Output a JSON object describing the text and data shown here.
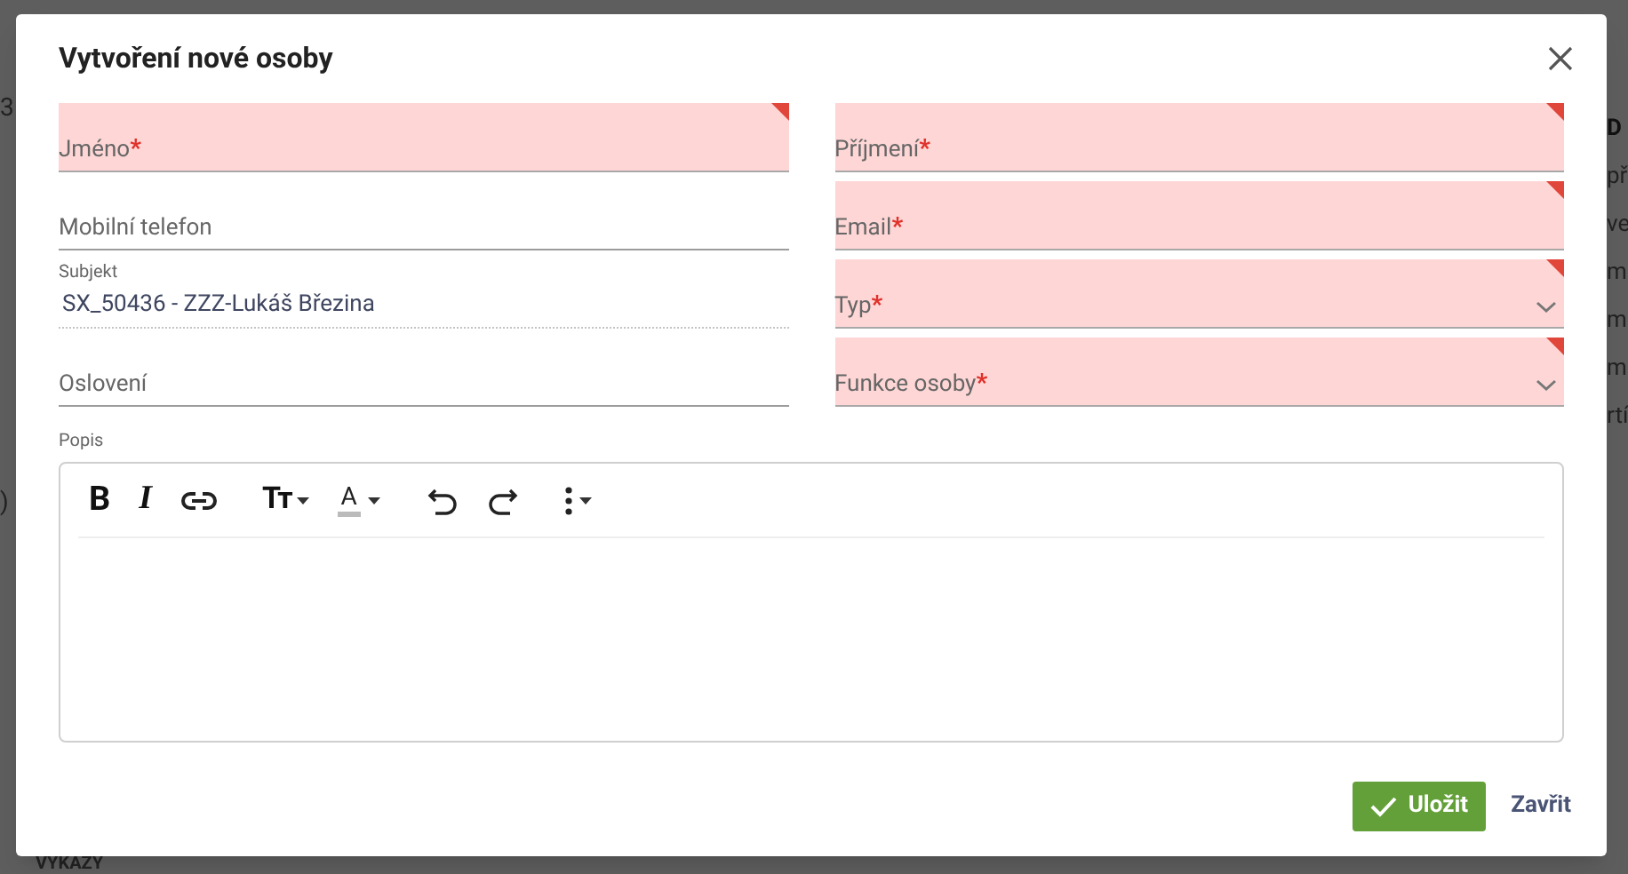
{
  "background": {
    "left_fragments": [
      "3",
      ")"
    ],
    "right_fragments": [
      "D",
      "př",
      "ve",
      "m",
      "m",
      "m",
      "rtí"
    ],
    "bottom_heading": "VÝKAZY"
  },
  "dialog": {
    "title": "Vytvoření nové osoby",
    "left_fields": [
      {
        "kind": "text",
        "label": "Jméno",
        "required_mark": "*",
        "invalid": true
      },
      {
        "kind": "text",
        "label": "Mobilní telefon",
        "invalid": false
      },
      {
        "kind": "lookup",
        "label": "Subjekt",
        "value": "SX_50436 - ZZZ-Lukáš Březina",
        "invalid": false
      },
      {
        "kind": "text",
        "label": "Oslovení",
        "invalid": false
      }
    ],
    "right_fields": [
      {
        "kind": "text",
        "label": "Příjmení",
        "required_mark": "*",
        "invalid": true
      },
      {
        "kind": "text",
        "label": "Email",
        "required_mark": "*",
        "invalid": true
      },
      {
        "kind": "select",
        "label": "Typ",
        "required_mark": "*",
        "invalid": true
      },
      {
        "kind": "select",
        "label": "Funkce osoby",
        "required_mark": "*",
        "invalid": true
      }
    ],
    "editor": {
      "label": "Popis",
      "tool_groups": [
        [
          {
            "kind": "bold",
            "glyph": "B"
          },
          {
            "kind": "italic",
            "glyph": "I"
          },
          {
            "kind": "link"
          }
        ],
        [
          {
            "kind": "size",
            "glyph": "Tт"
          },
          {
            "kind": "color",
            "glyph": "A"
          }
        ],
        [
          {
            "kind": "undo"
          },
          {
            "kind": "redo"
          }
        ],
        [
          {
            "kind": "more"
          }
        ]
      ]
    },
    "buttons": [
      {
        "kind": "primary",
        "label": "Uložit"
      },
      {
        "kind": "link",
        "label": "Zavřit"
      }
    ]
  }
}
